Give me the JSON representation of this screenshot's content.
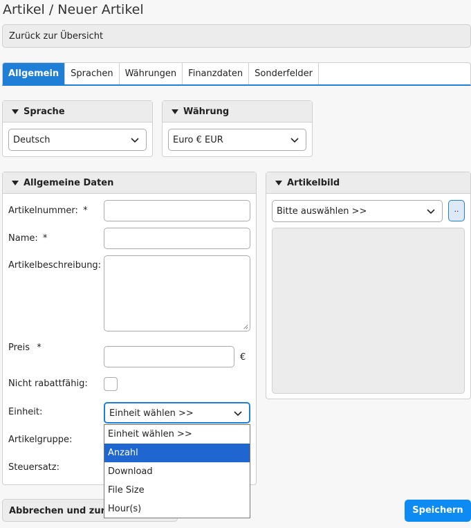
{
  "page": {
    "title": "Artikel / Neuer Artikel"
  },
  "back_link": "Zurück zur Übersicht",
  "tabs": [
    {
      "label": "Allgemein",
      "active": true
    },
    {
      "label": "Sprachen",
      "active": false
    },
    {
      "label": "Währungen",
      "active": false
    },
    {
      "label": "Finanzdaten",
      "active": false
    },
    {
      "label": "Sonderfelder",
      "active": false
    }
  ],
  "language_panel": {
    "title": "Sprache",
    "selected": "Deutsch"
  },
  "currency_panel": {
    "title": "Währung",
    "selected": "Euro € EUR"
  },
  "general_panel": {
    "title": "Allgemeine Daten",
    "article_number_label": "Artikelnummer:",
    "name_label": "Name:",
    "description_label": "Artikelbeschreibung:",
    "price_label": "Preis",
    "currency_symbol": "€",
    "not_discountable_label": "Nicht rabattfähig:",
    "unit_label": "Einheit:",
    "unit_selected": "Einheit wählen >>",
    "article_group_label": "Artikelgruppe:",
    "tax_rate_label": "Steuersatz:",
    "required_mark": "*"
  },
  "unit_dropdown": {
    "options": [
      {
        "label": "Einheit wählen >>",
        "highlighted": false
      },
      {
        "label": "Anzahl",
        "highlighted": true
      },
      {
        "label": "Download",
        "highlighted": false
      },
      {
        "label": "File Size",
        "highlighted": false
      },
      {
        "label": "Hour(s)",
        "highlighted": false
      }
    ]
  },
  "image_panel": {
    "title": "Artikelbild",
    "selected": "Bitte auswählen >>",
    "browse_label": ".."
  },
  "footer": {
    "cancel_label": "Abbrechen und zurück",
    "save_label": "Speichern"
  },
  "colors": {
    "accent": "#1f7fd6",
    "save_button": "#0d8bf2",
    "highlight": "#1f66d1"
  }
}
